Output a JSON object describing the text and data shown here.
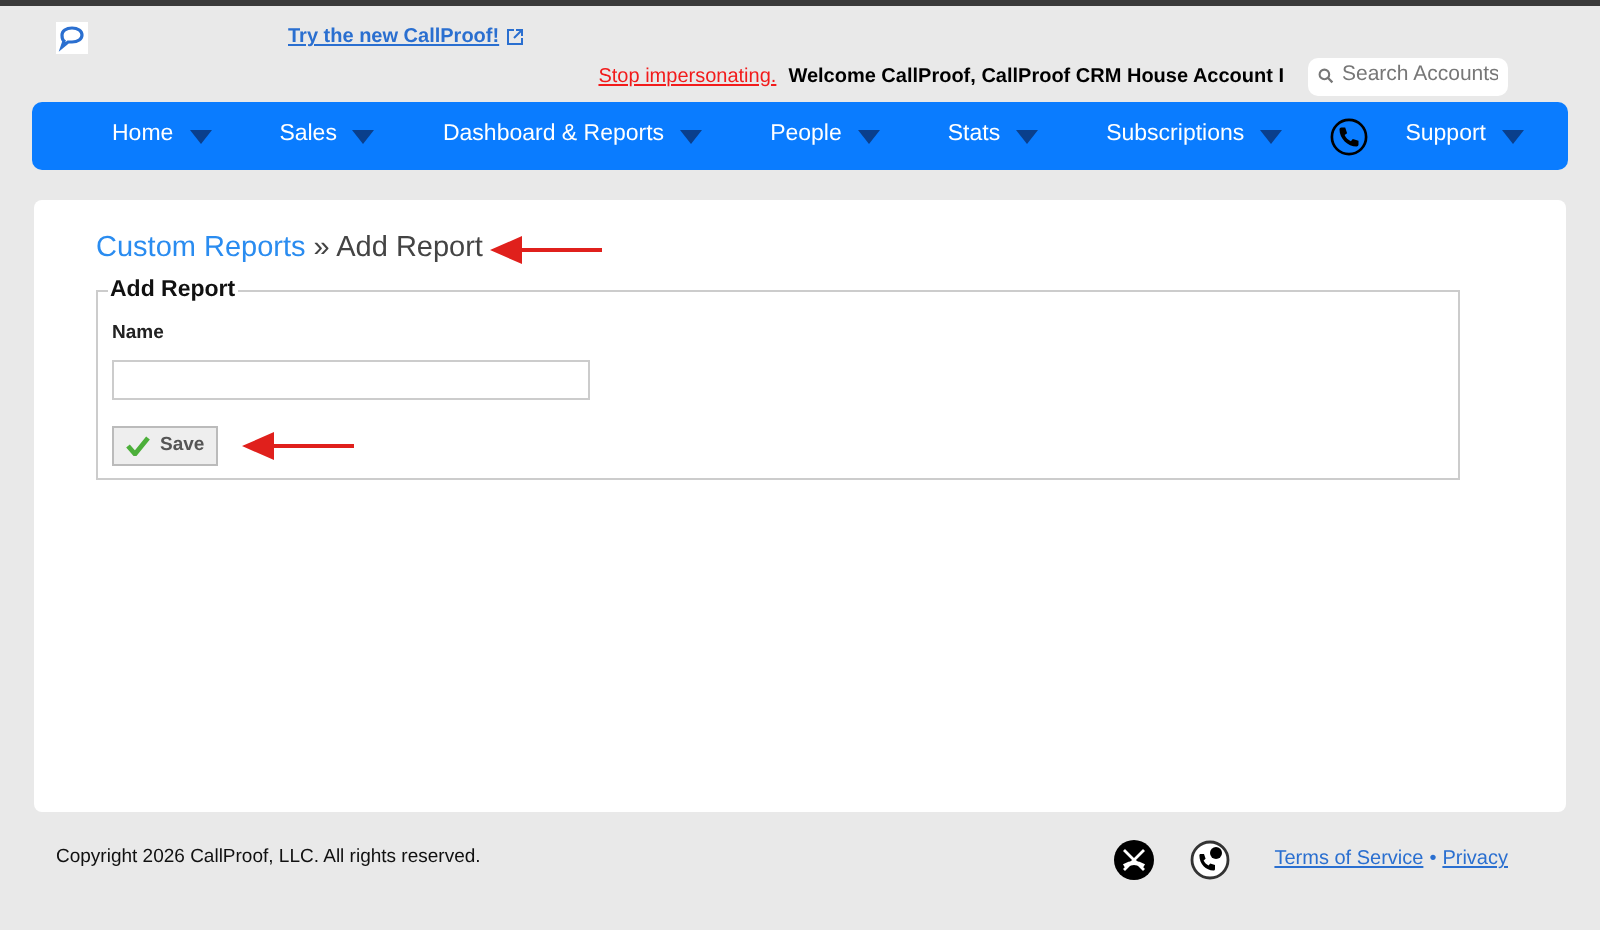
{
  "header": {
    "promo_link": "Try the new CallProof!",
    "stop_link": "Stop impersonating.",
    "welcome": "Welcome CallProof, CallProof CRM House Account I",
    "search": {
      "placeholder": "Search Accounts"
    }
  },
  "nav": {
    "items": [
      {
        "label": "Home"
      },
      {
        "label": "Sales"
      },
      {
        "label": "Dashboard & Reports"
      },
      {
        "label": "People"
      },
      {
        "label": "Stats"
      },
      {
        "label": "Subscriptions"
      }
    ],
    "support": {
      "label": "Support"
    }
  },
  "breadcrumb": {
    "parent": "Custom Reports",
    "separator": "»",
    "current": "Add Report"
  },
  "form": {
    "legend": "Add Report",
    "name_label": "Name",
    "save": "Save"
  },
  "footer": {
    "copyright": "Copyright 2026 CallProof, LLC. All rights reserved.",
    "links": [
      "Terms of Service",
      "Privacy"
    ],
    "separator": "•"
  }
}
